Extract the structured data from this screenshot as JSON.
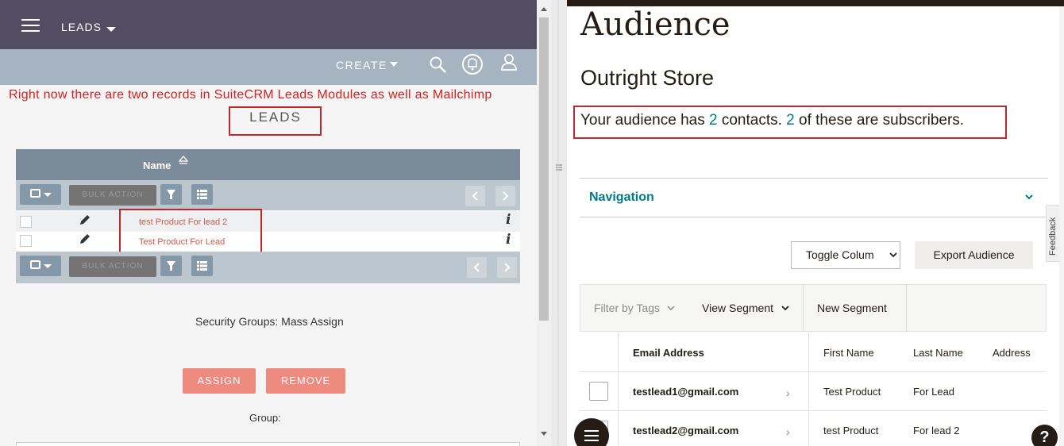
{
  "suitecrm": {
    "module_title": "LEADS",
    "create_label": "CREATE",
    "annotation": "Right now there are two records in SuiteCRM Leads Modules as well as Mailchimp",
    "page_heading": "LEADS",
    "column_name": "Name",
    "bulk_action_label": "BULK ACTION",
    "rows": [
      {
        "name": "test Product For lead 2"
      },
      {
        "name": "Test Product For Lead"
      }
    ],
    "security_groups_label": "Security Groups: Mass Assign",
    "assign_label": "ASSIGN",
    "remove_label": "REMOVE",
    "group_label": "Group:"
  },
  "mailchimp": {
    "page_title": "Audience",
    "store_name": "Outright Store",
    "audience_prefix": "Your audience has ",
    "contacts_count": "2",
    "audience_middle": " contacts. ",
    "subscribers_count": "2",
    "audience_suffix": " of these are subscribers.",
    "navigation_label": "Navigation",
    "feedback_label": "Feedback",
    "toggle_columns_label": "Toggle Colum",
    "export_label": "Export Audience",
    "filter_tags_label": "Filter by Tags",
    "view_segment_label": "View Segment",
    "new_segment_label": "New Segment",
    "columns": [
      "Email Address",
      "First Name",
      "Last Name",
      "Address"
    ],
    "contacts": [
      {
        "email": "testlead1@gmail.com",
        "first": "Test Product",
        "last": "For Lead"
      },
      {
        "email": "testlead2@gmail.com",
        "first": "test Product",
        "last": "For lead 2"
      }
    ],
    "help_label": "?"
  },
  "colors": {
    "annotation_red": "#c1272d",
    "crm_header": "#534d64",
    "mailchimp_teal": "#007c89"
  }
}
